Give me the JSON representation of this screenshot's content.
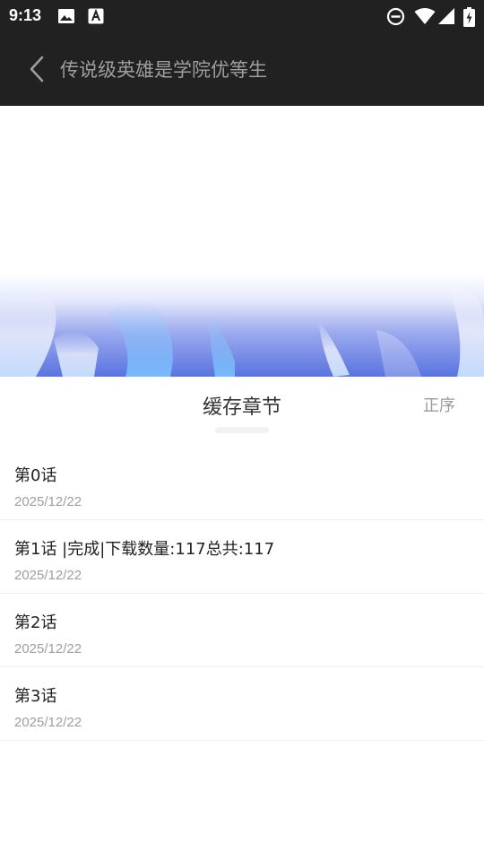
{
  "status_bar": {
    "time": "9:13",
    "left_icons": [
      "image-icon",
      "text-a-icon"
    ],
    "right_icons": [
      "do-not-disturb-icon",
      "wifi-icon",
      "signal-icon",
      "battery-charging-icon"
    ]
  },
  "app_bar": {
    "back_icon": "chevron-left-icon",
    "title": "传说级英雄是学院优等生"
  },
  "banner": {
    "accent_color": "#5a73e0"
  },
  "cache_panel": {
    "title": "缓存章节",
    "sort_label": "正序"
  },
  "chapters": [
    {
      "name": "第0话",
      "date": "2025/12/22"
    },
    {
      "name": "第1话 |完成|下载数量:117总共:117",
      "date": "2025/12/22"
    },
    {
      "name": "第2话",
      "date": "2025/12/22"
    },
    {
      "name": "第3话",
      "date": "2025/12/22"
    }
  ]
}
